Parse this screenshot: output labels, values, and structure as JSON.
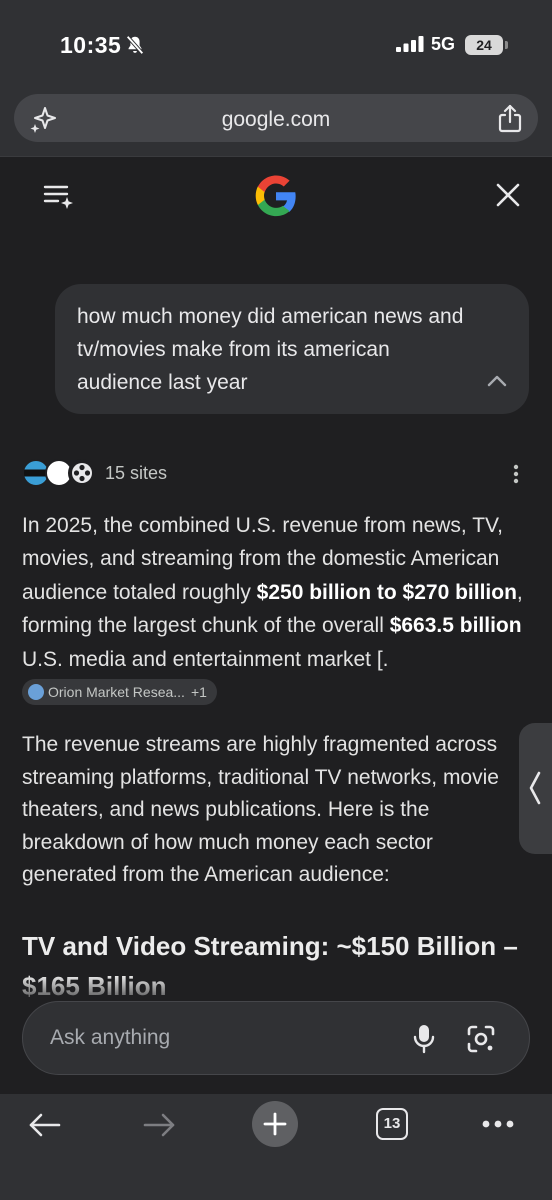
{
  "status_bar": {
    "time": "10:35",
    "network": "5G",
    "battery": "24"
  },
  "browser": {
    "url": "google.com"
  },
  "query": {
    "text": "how much money did american news and tv/movies make from its american audience last year"
  },
  "sources": {
    "count_label": "15 sites",
    "icons": [
      "film-site-icon",
      "pwc-logo-icon",
      "film-reel-icon"
    ]
  },
  "answer": {
    "p1_a": "In 2025, the combined U.S. revenue from news, TV, movies, and streaming from the domestic American audience totaled roughly ",
    "p1_bold1": "$250 billion to $270 billion",
    "p1_b": ", forming the largest chunk of the overall ",
    "p1_bold2": "$663.5 billion",
    "p1_c": " U.S. media and entertainment market [.",
    "chip_label": "Orion Market Resea...",
    "chip_more": "+1",
    "p2": "The revenue streams are highly fragmented across streaming platforms, traditional TV networks, movie theaters, and news publications. Here is the breakdown of how much money each sector generated from the American audience:",
    "heading": "TV and Video Streaming: ~$150 Billion – $165 Billion"
  },
  "ask_bar": {
    "placeholder": "Ask anything"
  },
  "nav": {
    "tab_count": "13"
  },
  "colors": {
    "background": "#1f1f21",
    "surface": "#303134",
    "text": "#e3e3e3",
    "muted": "#a8abb0"
  }
}
